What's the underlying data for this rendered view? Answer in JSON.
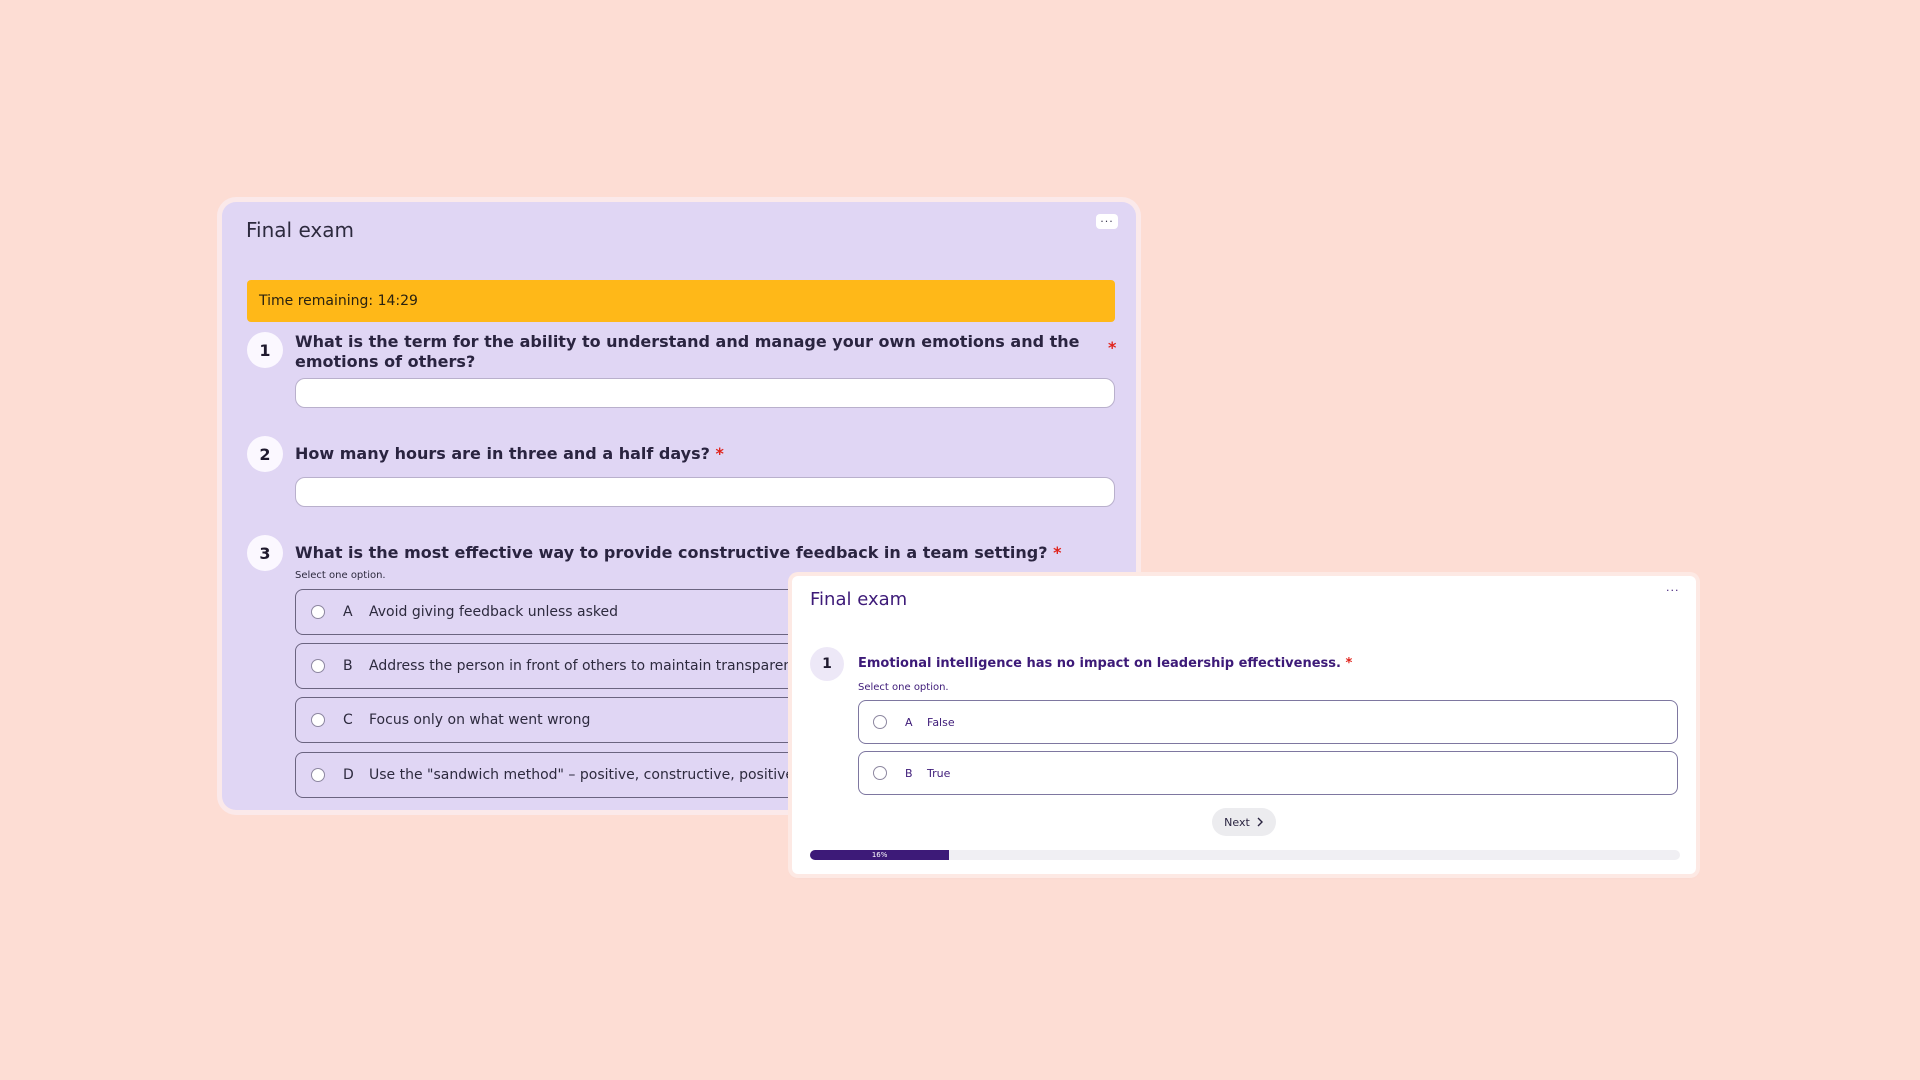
{
  "back_card": {
    "title": "Final exam",
    "more_label": "···",
    "timer": "Time remaining: 14:29",
    "required_mark": "*",
    "questions": [
      {
        "number": "1",
        "text": "What is the term for the ability to understand and manage your own emotions and the emotions of others?"
      },
      {
        "number": "2",
        "text": "How many hours are in three and a half days?"
      },
      {
        "number": "3",
        "text": "What is the most effective way to provide constructive feedback in a team setting?",
        "hint": "Select one option."
      }
    ],
    "options": [
      {
        "letter": "A",
        "text": "Avoid giving feedback unless asked"
      },
      {
        "letter": "B",
        "text": "Address the person in front of others to maintain transparency"
      },
      {
        "letter": "C",
        "text": "Focus only on what went wrong"
      },
      {
        "letter": "D",
        "text": "Use the \"sandwich method\" – positive, constructive, positive"
      }
    ]
  },
  "front_card": {
    "title": "Final exam",
    "more_label": "···",
    "question": {
      "number": "1",
      "text": "Emotional intelligence has no impact on leadership effectiveness.",
      "hint": "Select one option."
    },
    "required_mark": "*",
    "options": [
      {
        "letter": "A",
        "text": "False"
      },
      {
        "letter": "B",
        "text": "True"
      }
    ],
    "next_label": "Next",
    "next_icon": "chevron-right-icon",
    "progress_percent": 16,
    "progress_label": "16%"
  },
  "colors": {
    "page_background": "#fdddd4",
    "back_card": "#e0d6f4",
    "timer_banner": "#ffb818",
    "brand_purple": "#3d1a78",
    "required": "#e0231b"
  }
}
